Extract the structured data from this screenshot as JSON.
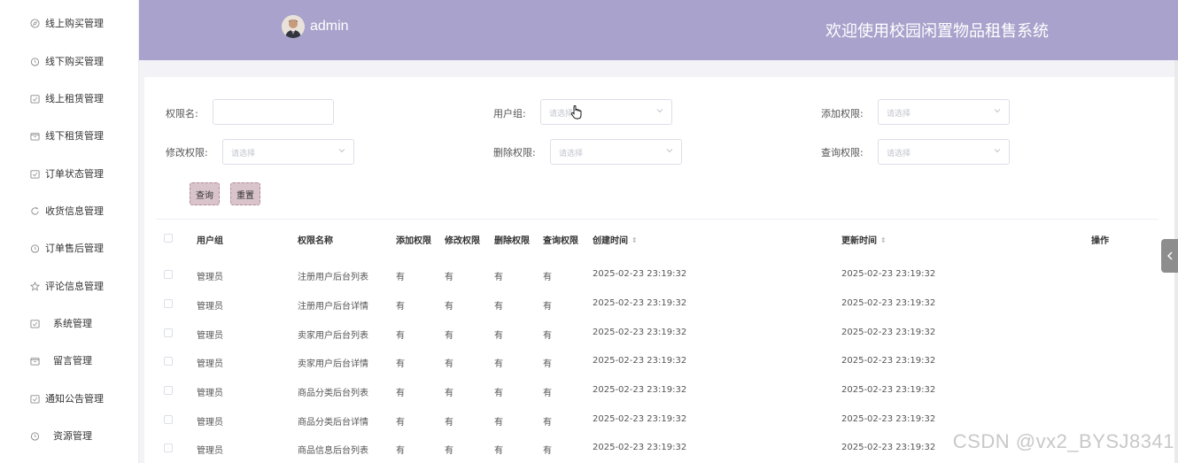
{
  "sidebar": {
    "items": [
      {
        "label": "线上购买管理",
        "icon": "compass-icon"
      },
      {
        "label": "线下购买管理",
        "icon": "timer-icon"
      },
      {
        "label": "线上租赁管理",
        "icon": "calendar-icon"
      },
      {
        "label": "线下租赁管理",
        "icon": "box-icon"
      },
      {
        "label": "订单状态管理",
        "icon": "calendar-icon"
      },
      {
        "label": "收货信息管理",
        "icon": "refresh-icon"
      },
      {
        "label": "订单售后管理",
        "icon": "timer-icon"
      },
      {
        "label": "评论信息管理",
        "icon": "star-icon"
      },
      {
        "label": "系统管理",
        "icon": "calendar-icon"
      },
      {
        "label": "留言管理",
        "icon": "box-icon"
      },
      {
        "label": "通知公告管理",
        "icon": "calendar-icon"
      },
      {
        "label": "资源管理",
        "icon": "timer-icon"
      }
    ]
  },
  "header": {
    "username": "admin",
    "title": "欢迎使用校园闲置物品租售系统",
    "bg_color": "#a9a2cc"
  },
  "search": {
    "perm_name_label": "权限名:",
    "user_group_label": "用户组:",
    "add_perm_label": "添加权限:",
    "edit_perm_label": "修改权限:",
    "delete_perm_label": "删除权限:",
    "query_perm_label": "查询权限:",
    "placeholder": "请选择",
    "query_button": "查询",
    "reset_button": "重置"
  },
  "table": {
    "headers": [
      "用户组",
      "权限名称",
      "添加权限",
      "修改权限",
      "删除权限",
      "查询权限",
      "创建时间",
      "更新时间",
      "操作"
    ],
    "rows": [
      [
        "管理员",
        "注册用户后台列表",
        "有",
        "有",
        "有",
        "有",
        "2025-02-23 23:19:32",
        "2025-02-23 23:19:32"
      ],
      [
        "管理员",
        "注册用户后台详情",
        "有",
        "有",
        "有",
        "有",
        "2025-02-23 23:19:32",
        "2025-02-23 23:19:32"
      ],
      [
        "管理员",
        "卖家用户后台列表",
        "有",
        "有",
        "有",
        "有",
        "2025-02-23 23:19:32",
        "2025-02-23 23:19:32"
      ],
      [
        "管理员",
        "卖家用户后台详情",
        "有",
        "有",
        "有",
        "有",
        "2025-02-23 23:19:32",
        "2025-02-23 23:19:32"
      ],
      [
        "管理员",
        "商品分类后台列表",
        "有",
        "有",
        "有",
        "有",
        "2025-02-23 23:19:32",
        "2025-02-23 23:19:32"
      ],
      [
        "管理员",
        "商品分类后台详情",
        "有",
        "有",
        "有",
        "有",
        "2025-02-23 23:19:32",
        "2025-02-23 23:19:32"
      ],
      [
        "管理员",
        "商品信息后台列表",
        "有",
        "有",
        "有",
        "有",
        "2025-02-23 23:19:32",
        "2025-02-23 23:19:32"
      ]
    ]
  },
  "watermark": "CSDN @vx2_BYSJ8341"
}
